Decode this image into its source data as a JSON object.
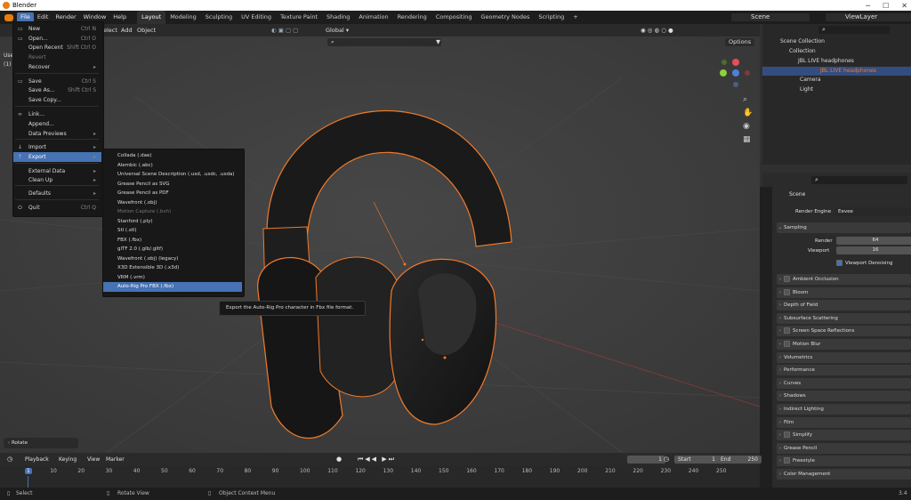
{
  "window": {
    "title": "Blender",
    "min": "─",
    "max": "☐",
    "close": "✕"
  },
  "menubar": [
    "File",
    "Edit",
    "Render",
    "Window",
    "Help"
  ],
  "workspaces": [
    "Layout",
    "Modeling",
    "Sculpting",
    "UV Editing",
    "Texture Paint",
    "Shading",
    "Animation",
    "Rendering",
    "Compositing",
    "Geometry Nodes",
    "Scripting"
  ],
  "add_workspace": "+",
  "scene": "Scene",
  "view_layer": "ViewLayer",
  "viewport_header": {
    "select": "elect",
    "add": "Add",
    "object": "Object",
    "orientation": "Global",
    "options": "Options"
  },
  "viewport_left": {
    "user": "Use",
    "num": "(1)"
  },
  "file_menu": [
    {
      "label": "New",
      "shortcut": "Ctrl N",
      "icon": "▭",
      "submenu": true
    },
    {
      "label": "Open...",
      "shortcut": "Ctrl O",
      "icon": "▭"
    },
    {
      "label": "Open Recent",
      "shortcut": "Shift Ctrl O",
      "submenu": true
    },
    {
      "label": "Revert",
      "disabled": true
    },
    {
      "label": "Recover",
      "submenu": true
    },
    {
      "label": "Save",
      "shortcut": "Ctrl S",
      "icon": "▭"
    },
    {
      "label": "Save As...",
      "shortcut": "Shift Ctrl S"
    },
    {
      "label": "Save Copy..."
    },
    {
      "label": "Link...",
      "icon": "∞"
    },
    {
      "label": "Append..."
    },
    {
      "label": "Data Previews",
      "submenu": true
    },
    {
      "label": "Import",
      "icon": "↓",
      "submenu": true
    },
    {
      "label": "Export",
      "icon": "↑",
      "submenu": true,
      "highlight": true
    },
    {
      "label": "External Data",
      "submenu": true
    },
    {
      "label": "Clean Up",
      "submenu": true
    },
    {
      "label": "Defaults",
      "submenu": true
    },
    {
      "label": "Quit",
      "shortcut": "Ctrl Q",
      "icon": "⏻"
    }
  ],
  "export_menu": [
    {
      "label": "Collada (.dae)"
    },
    {
      "label": "Alembic (.abc)"
    },
    {
      "label": "Universal Scene Description (.usd, .usdc, .usda)"
    },
    {
      "label": "Grease Pencil as SVG"
    },
    {
      "label": "Grease Pencil as PDF"
    },
    {
      "label": "Wavefront (.obj)"
    },
    {
      "label": "Motion Capture (.bvh)",
      "disabled": true
    },
    {
      "label": "Stanford (.ply)"
    },
    {
      "label": "Stl (.stl)"
    },
    {
      "label": "FBX (.fbx)"
    },
    {
      "label": "glTF 2.0 (.glb/.gltf)"
    },
    {
      "label": "Wavefront (.obj) (legacy)"
    },
    {
      "label": "X3D Extensible 3D (.x3d)"
    },
    {
      "label": "VRM (.vrm)"
    },
    {
      "label": "Auto-Rig Pro FBX (.fbx)",
      "highlight": true
    }
  ],
  "tooltip": "Export the Auto-Rig Pro character in Fbx file format.",
  "last_op": "Rotate",
  "outliner": {
    "root": "Scene Collection",
    "items": [
      {
        "label": "Collection",
        "indent": 1
      },
      {
        "label": "JBL LIVE headphones",
        "indent": 2
      },
      {
        "label": "JBL LIVE headphones",
        "indent": 3,
        "selected": true
      },
      {
        "label": "Camera",
        "indent": 2
      },
      {
        "label": "Light",
        "indent": 2
      }
    ]
  },
  "properties": {
    "scene": "Scene",
    "render_engine_label": "Render Engine",
    "render_engine": "Eevee",
    "sampling": "Sampling",
    "render_label": "Render",
    "render_value": "64",
    "viewport_label": "Viewport",
    "viewport_value": "16",
    "denoise": "Viewport Denoising",
    "panels": [
      {
        "label": "Ambient Occlusion",
        "checkbox": true
      },
      {
        "label": "Bloom",
        "checkbox": true
      },
      {
        "label": "Depth of Field"
      },
      {
        "label": "Subsurface Scattering"
      },
      {
        "label": "Screen Space Reflections",
        "checkbox": true
      },
      {
        "label": "Motion Blur",
        "checkbox": true
      },
      {
        "label": "Volumetrics"
      },
      {
        "label": "Performance"
      },
      {
        "label": "Curves"
      },
      {
        "label": "Shadows"
      },
      {
        "label": "Indirect Lighting"
      },
      {
        "label": "Film"
      },
      {
        "label": "Simplify",
        "checkbox": true
      },
      {
        "label": "Grease Pencil"
      },
      {
        "label": "Freestyle",
        "checkbox": true
      },
      {
        "label": "Color Management"
      }
    ]
  },
  "timeline": {
    "playback": "Playback",
    "keying": "Keying",
    "view": "View",
    "marker": "Marker",
    "current": "1",
    "start_label": "Start",
    "start": "1",
    "end_label": "End",
    "end": "250",
    "ticks": [
      "1",
      "10",
      "20",
      "30",
      "40",
      "50",
      "60",
      "70",
      "80",
      "90",
      "100",
      "110",
      "120",
      "130",
      "140",
      "150",
      "160",
      "170",
      "180",
      "190",
      "200",
      "210",
      "220",
      "230",
      "240",
      "250"
    ]
  },
  "status": {
    "select": "Select",
    "rotate": "Rotate View",
    "context": "Object Context Menu",
    "version": "3.4"
  },
  "colors": {
    "accent": "#4772b3",
    "selection_outline": "#f07a2a"
  }
}
